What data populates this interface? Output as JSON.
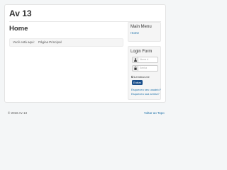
{
  "header": {
    "site_title": "Av 13"
  },
  "main": {
    "page_heading": "Home",
    "breadcrumb": {
      "prefix": "Você está aqui:",
      "current": "Página Principal"
    }
  },
  "sidebar": {
    "main_menu": {
      "heading": "Main Menu",
      "items": [
        {
          "label": "Home"
        }
      ]
    },
    "login_form": {
      "heading": "Login Form",
      "username_placeholder": "Nome d",
      "password_placeholder": "Senha",
      "remember_label": "Lembrar-me",
      "submit_label": "Entrar",
      "forgot_username_label": "Esqueceu seu usuário?",
      "forgot_password_label": "Esqueceu sua senha?"
    }
  },
  "footer": {
    "copyright": "© 2016 Av 13",
    "back_to_top_label": "Voltar ao Topo"
  },
  "icons": {
    "user": "user-icon",
    "lock": "lock-icon"
  },
  "colors": {
    "link": "#1a6fa8",
    "button": "#1a4f8b",
    "background": "#f4f6f7"
  }
}
